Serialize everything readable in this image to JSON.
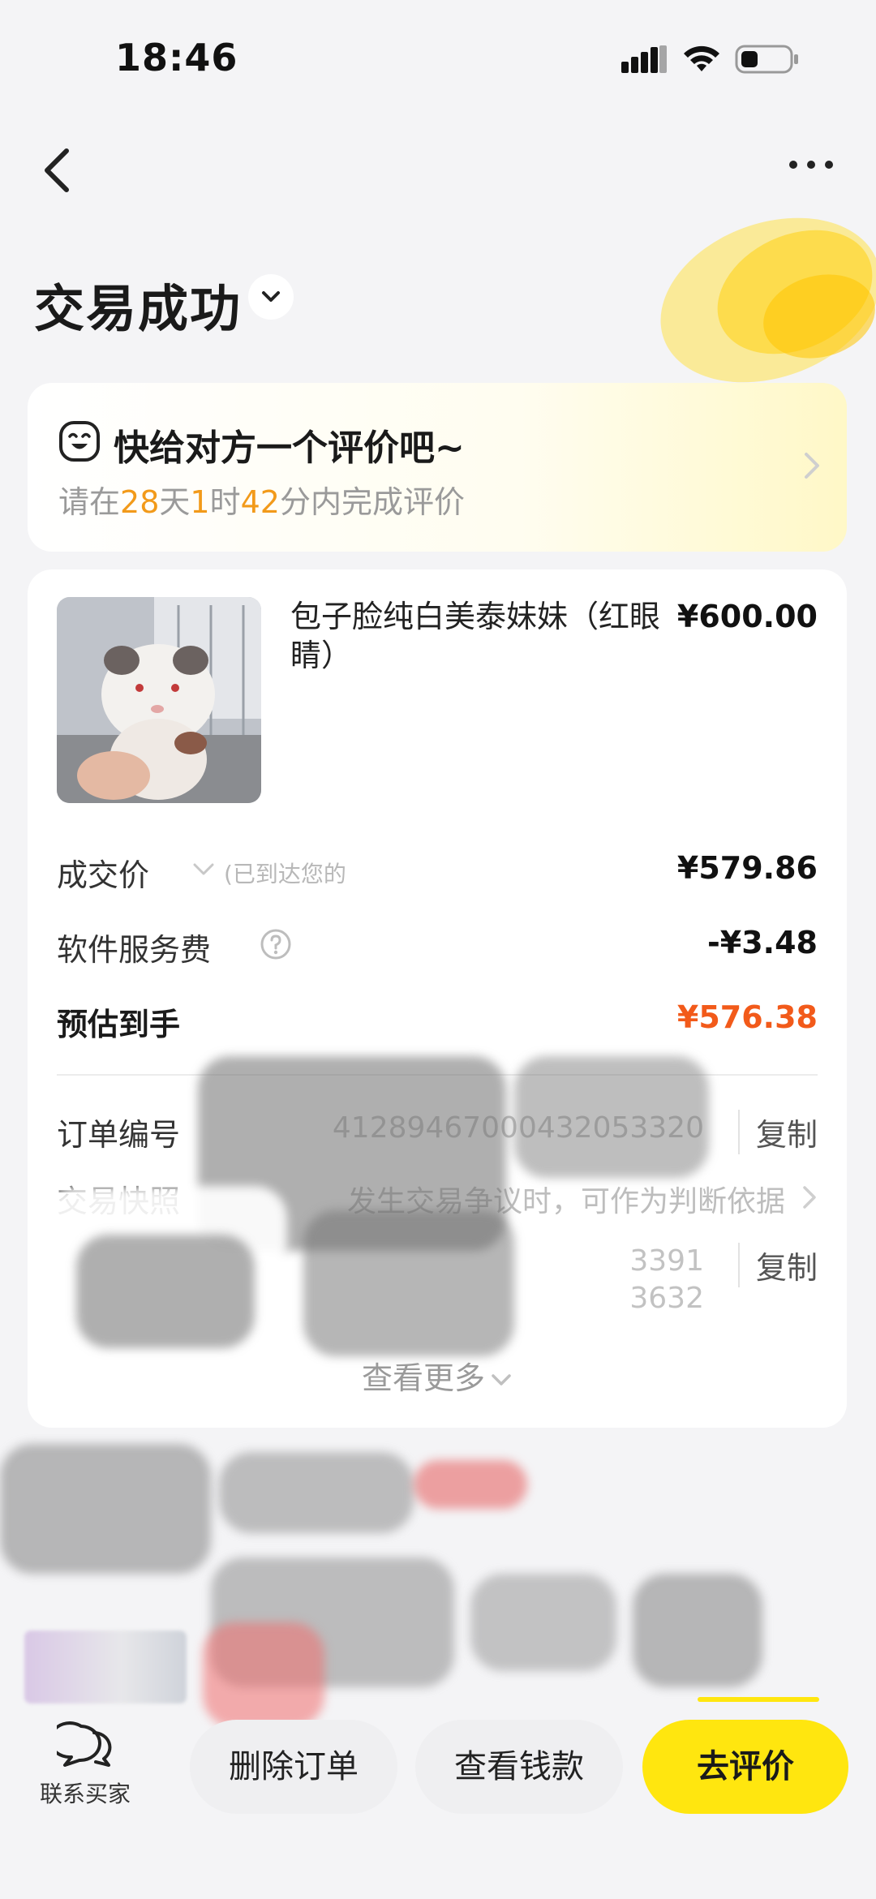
{
  "status_bar": {
    "time": "18:46"
  },
  "header": {
    "order_status": "交易成功"
  },
  "review_prompt": {
    "title": "快给对方一个评价吧~",
    "prefix": "请在",
    "days": "28",
    "day_unit": "天",
    "hours": "1",
    "hour_unit": "时",
    "minutes": "42",
    "minute_unit": "分内完成评价"
  },
  "product": {
    "title": "包子脸纯白美泰妹妹（红眼睛）",
    "price": "¥600.00"
  },
  "fees": {
    "deal_price_label": "成交价",
    "deal_price_note": "(已到达您的",
    "deal_price_value": "¥579.86",
    "service_fee_label": "软件服务费",
    "service_fee_value": "-¥3.48",
    "estimated_label": "预估到手",
    "estimated_value": "¥576.38"
  },
  "order_info": {
    "order_no_label": "订单编号",
    "order_no_value": "41289467000432053320",
    "copy_label": "复制",
    "snapshot_label": "交易快照",
    "snapshot_value": "发生交易争议时，可作为判断依据",
    "third_value_line1": "3391",
    "third_value_line2": "3632",
    "copy_label_2": "复制",
    "view_more": "查看更多"
  },
  "bottom_bar": {
    "contact_label": "联系买家",
    "delete_order": "删除订单",
    "view_payment": "查看钱款",
    "go_review": "去评价"
  },
  "colors": {
    "accent_yellow": "#ffe60f",
    "orange_highlight": "#f29a1a",
    "estimated_red": "#f25a1a",
    "background": "#f4f4f6"
  }
}
